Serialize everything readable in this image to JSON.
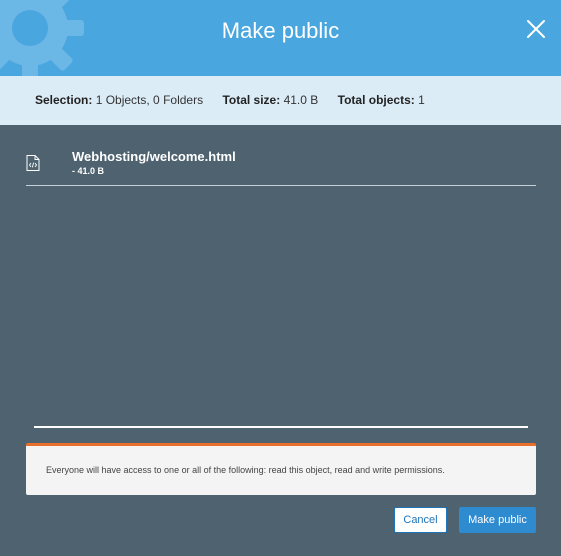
{
  "dialog": {
    "title": "Make public"
  },
  "summary": {
    "selection_label": "Selection:",
    "selection_value": "1 Objects, 0 Folders",
    "size_label": "Total size:",
    "size_value": "41.0 B",
    "objects_label": "Total objects:",
    "objects_value": "1"
  },
  "file": {
    "name": "Webhosting/welcome.html",
    "size": "- 41.0 B",
    "icon": "html-file-icon"
  },
  "warning": {
    "message": "Everyone will have access to one or all of the following: read this object, read and write permissions."
  },
  "buttons": {
    "cancel": "Cancel",
    "confirm": "Make public"
  },
  "colors": {
    "header": "#4aa6df",
    "summary_bg": "#dcecf7",
    "body_bg": "#4e6270",
    "warning_accent": "#e8702a",
    "primary": "#2f8bd0"
  }
}
